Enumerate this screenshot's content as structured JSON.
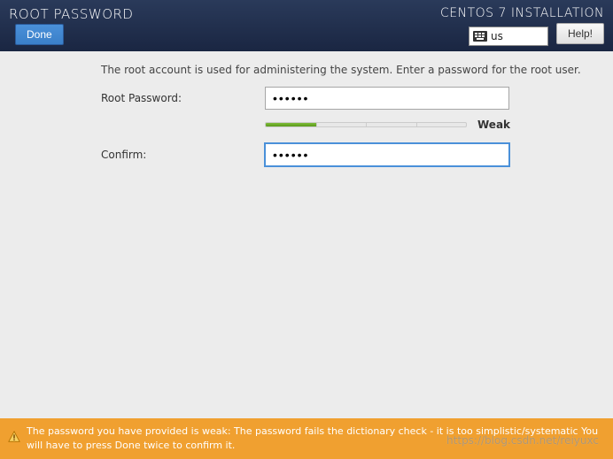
{
  "header": {
    "title": "ROOT PASSWORD",
    "subtitle": "CENTOS 7 INSTALLATION",
    "done_label": "Done",
    "help_label": "Help!",
    "keyboard_layout": "us"
  },
  "form": {
    "instruction": "The root account is used for administering the system.  Enter a password for the root user.",
    "password_label": "Root Password:",
    "confirm_label": "Confirm:",
    "password_value": "••••••",
    "confirm_value": "••••••",
    "strength_label": "Weak",
    "strength_percent": 25
  },
  "warning": {
    "text": "The password you have provided is weak: The password fails the dictionary check - it is too simplistic/systematic You will have to press Done twice to confirm it."
  },
  "watermark": "https://blog.csdn.net/reiyuxc"
}
